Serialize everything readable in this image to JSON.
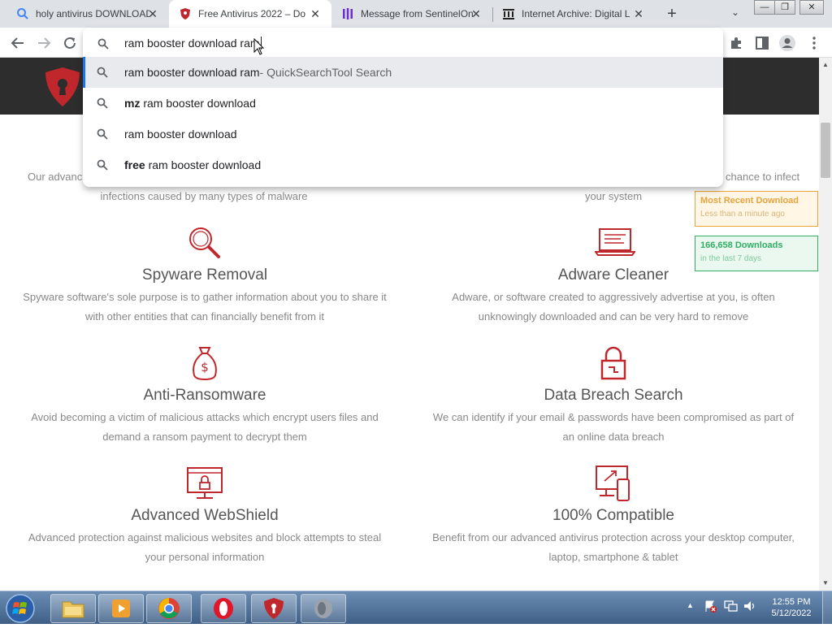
{
  "tabs": [
    {
      "title": "holy antivirus DOWNLOAD",
      "favicon": "google-search-icon",
      "active": false
    },
    {
      "title": "Free Antivirus 2022 – Do",
      "favicon": "shield-logo-icon",
      "active": true
    },
    {
      "title": "Message from SentinelOn",
      "favicon": "sentinelone-icon",
      "active": false
    },
    {
      "title": "Internet Archive: Digital L",
      "favicon": "archive-icon",
      "active": false
    }
  ],
  "omnibox": {
    "query": "ram booster download ram",
    "suggestions": [
      {
        "bold": "",
        "text": "ram booster download ram",
        "desc": " - QuickSearchTool Search",
        "selected": true
      },
      {
        "bold": "mz",
        "text": " ram booster download",
        "desc": "",
        "selected": false
      },
      {
        "bold": "",
        "text": "ram booster download",
        "desc": "",
        "selected": false
      },
      {
        "bold": "free",
        "text": " ram booster download",
        "desc": "",
        "selected": false
      }
    ]
  },
  "page": {
    "partial": {
      "left_line1": "Our advanc",
      "left_line2": "infections caused by many types of malware",
      "right_line1": "chance to infect",
      "right_line2": "your system"
    },
    "side_cards": [
      {
        "line1": "Most Recent Download",
        "line2": "Less than a minute ago",
        "color": "#e8a33d",
        "bg": "#fff6e6"
      },
      {
        "line1": "166,658 Downloads",
        "line2": "in the last 7 days",
        "color": "#2fae64",
        "bg": "#eaf8ef"
      }
    ],
    "features": [
      {
        "icon": "magnifier-icon",
        "title": "Spyware Removal",
        "desc": [
          "Spyware software's sole purpose is to gather information about you to share it",
          "with other entities that can financially benefit from it"
        ]
      },
      {
        "icon": "laptop-icon",
        "title": "Adware Cleaner",
        "desc": [
          "Adware, or software created to aggressively advertise at you, is often",
          "unknowingly downloaded and can be very hard to remove"
        ]
      },
      {
        "icon": "money-bag-icon",
        "title": "Anti-Ransomware",
        "desc": [
          "Avoid becoming a victim of malicious attacks which encrypt users files and",
          "demand a ransom payment to decrypt them"
        ]
      },
      {
        "icon": "lock-icon",
        "title": "Data Breach Search",
        "desc": [
          "We can identify if your email & passwords have been compromised as part of",
          "an online data breach"
        ]
      },
      {
        "icon": "monitor-lock-icon",
        "title": "Advanced WebShield",
        "desc": [
          "Advanced protection against malicious websites and block attempts to steal",
          "your personal information"
        ]
      },
      {
        "icon": "devices-icon",
        "title": "100% Compatible",
        "desc": [
          "Benefit from our advanced antivirus protection across your desktop computer,",
          "laptop, smartphone & tablet"
        ]
      }
    ],
    "accent": "#c0272d"
  },
  "taskbar": {
    "time": "12:55 PM",
    "date": "5/12/2022"
  }
}
